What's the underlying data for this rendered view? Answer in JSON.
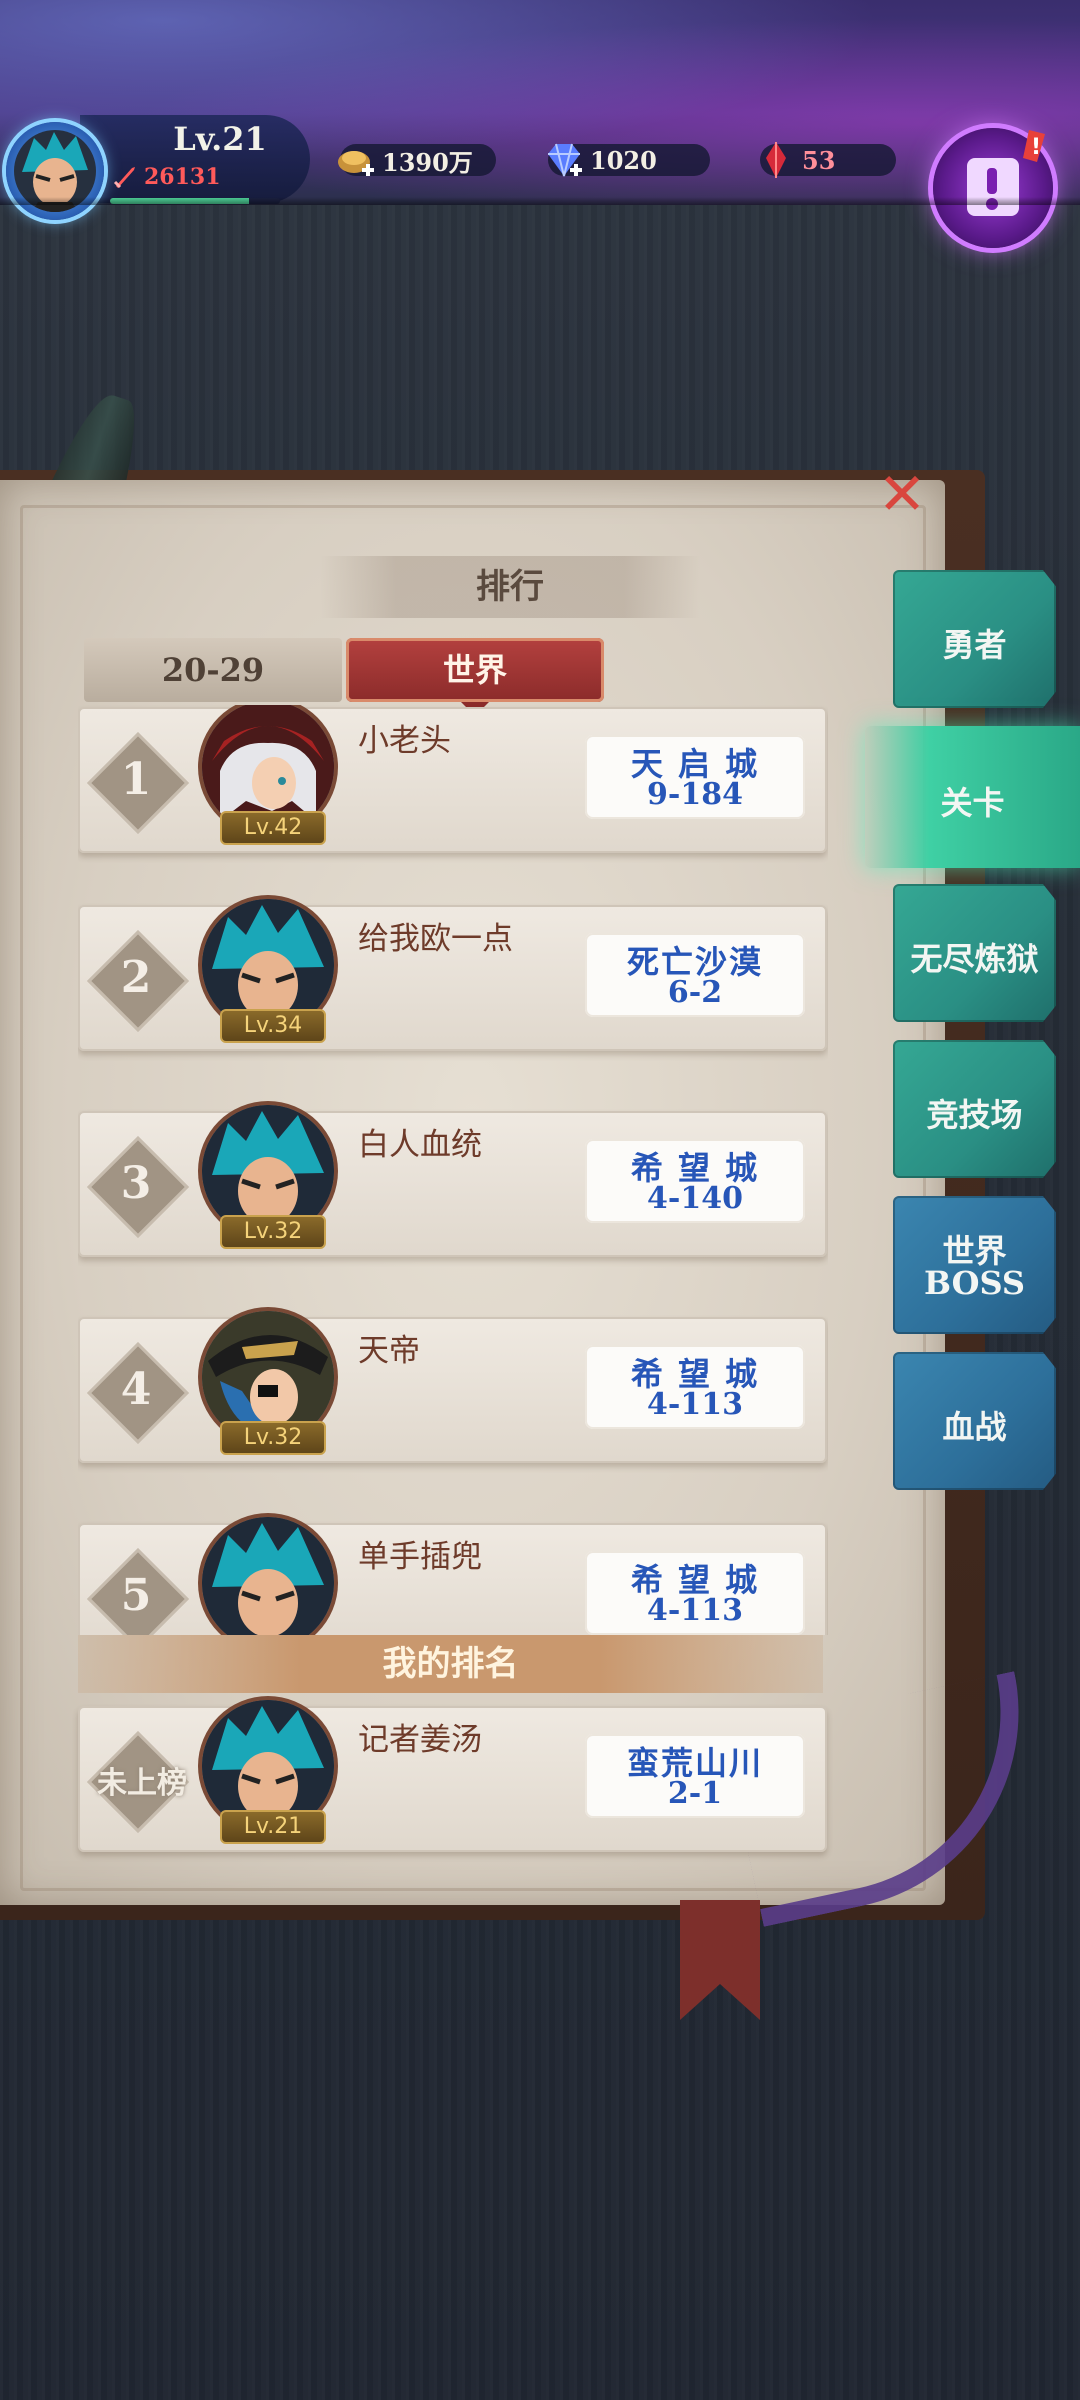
{
  "header": {
    "level": "Lv.21",
    "power": "26131",
    "xp_fraction": 0.82,
    "resources": [
      {
        "name": "gold",
        "icon": "gold-ingot-icon",
        "value": "1390万"
      },
      {
        "name": "diamond",
        "icon": "diamond-icon",
        "value": "1020"
      },
      {
        "name": "ruby",
        "icon": "ruby-icon",
        "value": "53"
      }
    ]
  },
  "page": {
    "title": "排行",
    "tabs": [
      "20-29",
      "世界"
    ],
    "active_tab": "世界"
  },
  "rankings": [
    {
      "rank": "1",
      "name": "小老头",
      "level": "Lv.42",
      "stage_name": "天 启 城",
      "stage_num": "9-184"
    },
    {
      "rank": "2",
      "name": "给我欧一点",
      "level": "Lv.34",
      "stage_name": "死亡沙漠",
      "stage_num": "6-2"
    },
    {
      "rank": "3",
      "name": "白人血统",
      "level": "Lv.32",
      "stage_name": "希 望 城",
      "stage_num": "4-140"
    },
    {
      "rank": "4",
      "name": "天帝",
      "level": "Lv.32",
      "stage_name": "希 望 城",
      "stage_num": "4-113"
    },
    {
      "rank": "5",
      "name": "单手插兜",
      "level": "",
      "stage_name": "希 望 城",
      "stage_num": "4-113"
    }
  ],
  "my_rank": {
    "header": "我的排名",
    "rank": "未上榜",
    "name": "记者姜汤",
    "level": "Lv.21",
    "stage_name": "蛮荒山川",
    "stage_num": "2-1"
  },
  "side_menu": [
    {
      "label": "勇者",
      "active": false
    },
    {
      "label": "关卡",
      "active": true
    },
    {
      "label": "无尽炼狱",
      "active": false
    },
    {
      "label": "竞技场",
      "active": false
    },
    {
      "label": "世界",
      "label2": "BOSS",
      "active": false
    },
    {
      "label": "血战",
      "active": false
    }
  ],
  "colors": {
    "accent": "#8b2b2a",
    "stage_text": "#2756b8",
    "menu_green": "#2a8f84",
    "menu_blue": "#2d6f9a"
  }
}
